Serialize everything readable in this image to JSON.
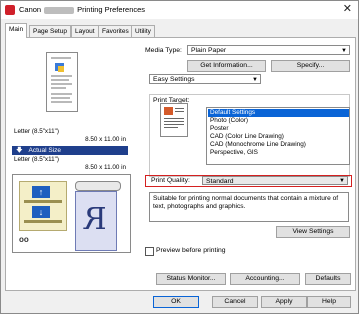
{
  "window": {
    "title_prefix": "Canon",
    "title_suffix": "Printing Preferences",
    "close_glyph": "✕"
  },
  "tabs": [
    {
      "label": "Main"
    },
    {
      "label": "Page Setup"
    },
    {
      "label": "Layout"
    },
    {
      "label": "Favorites"
    },
    {
      "label": "Utility"
    }
  ],
  "preview": {
    "paper_line1": "Letter (8.5\"x11\")",
    "paper_line2": "8.50 x 11.00 in",
    "actual_size": "Actual Size",
    "output_line1": "Letter (8.5\"x11\")",
    "output_line2": "8.50 x 11.00 in"
  },
  "media": {
    "label": "Media Type:",
    "value": "Plain Paper",
    "get_info_button": "Get Information...",
    "specify_button": "Specify..."
  },
  "settings_mode": {
    "value": "Easy Settings"
  },
  "print_target": {
    "label": "Print Target:",
    "items": [
      "Default Settings",
      "Photo (Color)",
      "Poster",
      "CAD (Color Line Drawing)",
      "CAD (Monochrome Line Drawing)",
      "Perspective, GIS"
    ],
    "selected_index": 0
  },
  "print_quality": {
    "label": "Print Quality:",
    "value": "Standard",
    "description": "Suitable for printing normal documents that contain a mixture of text, photographs and graphics.",
    "view_settings_button": "View Settings"
  },
  "preview_before_printing": {
    "label": "Preview before printing",
    "checked": false
  },
  "buttons": {
    "status_monitor": "Status Monitor...",
    "accounting": "Accounting...",
    "defaults": "Defaults",
    "ok": "OK",
    "cancel": "Cancel",
    "apply": "Apply",
    "help": "Help"
  },
  "colors": {
    "highlight": "#0a64d6",
    "actual_size_bar": "#1f3f8c",
    "quality_border": "#d42020"
  }
}
